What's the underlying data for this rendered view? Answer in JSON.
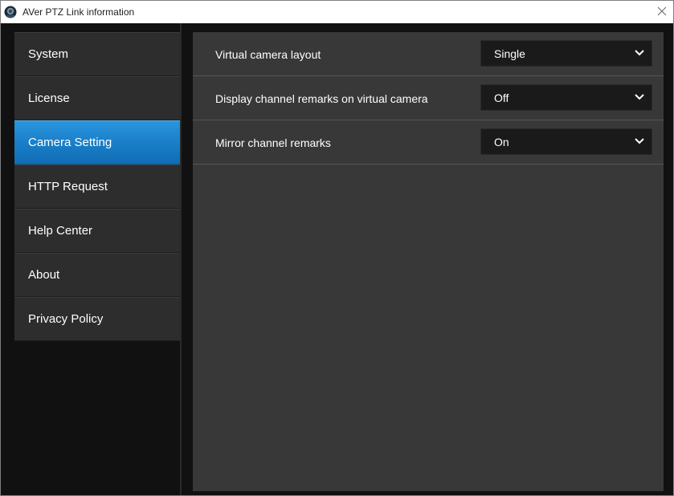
{
  "window": {
    "title": "AVer PTZ Link information"
  },
  "sidebar": {
    "items": [
      {
        "label": "System"
      },
      {
        "label": "License"
      },
      {
        "label": "Camera Setting",
        "active": true
      },
      {
        "label": "HTTP Request"
      },
      {
        "label": "Help Center"
      },
      {
        "label": "About"
      },
      {
        "label": "Privacy Policy"
      }
    ]
  },
  "settings": [
    {
      "label": "Virtual camera layout",
      "value": "Single"
    },
    {
      "label": "Display channel remarks on virtual camera",
      "value": "Off"
    },
    {
      "label": "Mirror channel remarks",
      "value": "On"
    }
  ],
  "colors": {
    "accent": "#1a7fc8",
    "sidebar_bg": "#2d2d2d",
    "content_bg": "#383838",
    "window_bg": "#111111"
  },
  "icons": {
    "app": "aver-logo-icon",
    "close": "close-icon",
    "dropdown": "chevron-down-icon"
  }
}
